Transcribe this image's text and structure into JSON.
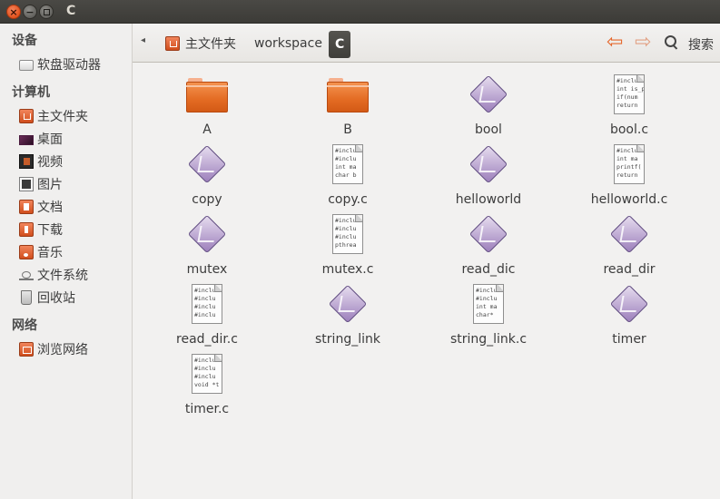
{
  "window": {
    "title": "C"
  },
  "sidebar": {
    "sections": [
      {
        "heading": "设备",
        "items": [
          {
            "label": "软盘驱动器",
            "icon": "floppy-drive-icon"
          }
        ]
      },
      {
        "heading": "计算机",
        "items": [
          {
            "label": "主文件夹",
            "icon": "home-folder-icon"
          },
          {
            "label": "桌面",
            "icon": "desktop-icon"
          },
          {
            "label": "视频",
            "icon": "video-folder-icon"
          },
          {
            "label": "图片",
            "icon": "pictures-folder-icon"
          },
          {
            "label": "文档",
            "icon": "documents-folder-icon"
          },
          {
            "label": "下载",
            "icon": "downloads-folder-icon"
          },
          {
            "label": "音乐",
            "icon": "music-folder-icon"
          },
          {
            "label": "文件系统",
            "icon": "filesystem-icon"
          },
          {
            "label": "回收站",
            "icon": "trash-icon"
          }
        ]
      },
      {
        "heading": "网络",
        "items": [
          {
            "label": "浏览网络",
            "icon": "network-icon"
          }
        ]
      }
    ]
  },
  "toolbar": {
    "breadcrumbs": [
      "主文件夹",
      "workspace",
      "C"
    ],
    "search_label": "搜索"
  },
  "files": [
    {
      "name": "A",
      "type": "folder"
    },
    {
      "name": "B",
      "type": "folder"
    },
    {
      "name": "bool",
      "type": "executable"
    },
    {
      "name": "bool.c",
      "type": "text",
      "preview": [
        "#inclu",
        "int is_p",
        "if(num",
        "return"
      ]
    },
    {
      "name": "copy",
      "type": "executable"
    },
    {
      "name": "copy.c",
      "type": "text",
      "preview": [
        "#inclu",
        "#inclu",
        "int ma",
        "char b"
      ]
    },
    {
      "name": "helloworld",
      "type": "executable"
    },
    {
      "name": "helloworld.c",
      "type": "text",
      "preview": [
        "#inclu",
        "int ma",
        "printf(",
        "return"
      ]
    },
    {
      "name": "mutex",
      "type": "executable"
    },
    {
      "name": "mutex.c",
      "type": "text",
      "preview": [
        "#inclu",
        "#inclu",
        "#inclu",
        "pthrea"
      ]
    },
    {
      "name": "read_dic",
      "type": "executable"
    },
    {
      "name": "read_dir",
      "type": "executable"
    },
    {
      "name": "read_dir.c",
      "type": "text",
      "preview": [
        "#inclu",
        "#inclu",
        "#inclu",
        "#inclu"
      ]
    },
    {
      "name": "string_link",
      "type": "executable"
    },
    {
      "name": "string_link.c",
      "type": "text",
      "preview": [
        "#inclu",
        "#inclu",
        "int ma",
        "char*"
      ]
    },
    {
      "name": "timer",
      "type": "executable"
    },
    {
      "name": "timer.c",
      "type": "text",
      "preview": [
        "#inclu",
        "#inclu",
        "#inclu",
        "void *t"
      ]
    }
  ]
}
